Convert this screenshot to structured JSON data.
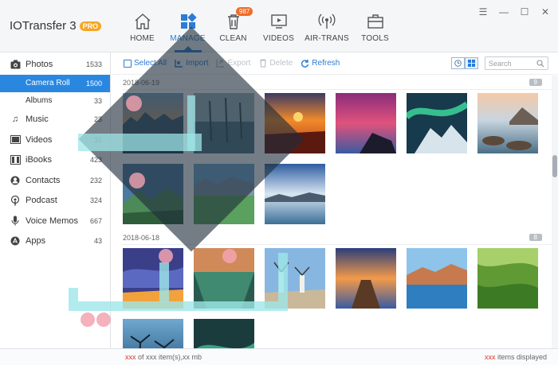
{
  "app": {
    "title": "IOTransfer 3",
    "pro_badge": "PRO"
  },
  "nav": {
    "items": [
      {
        "id": "home",
        "label": "HOME",
        "icon": "home-icon"
      },
      {
        "id": "manage",
        "label": "MANAGE",
        "icon": "grid-icon",
        "active": true
      },
      {
        "id": "clean",
        "label": "CLEAN",
        "icon": "trash-icon",
        "badge": "987"
      },
      {
        "id": "videos",
        "label": "VIDEOS",
        "icon": "video-icon"
      },
      {
        "id": "airtrans",
        "label": "AIR-TRANS",
        "icon": "wifi-icon"
      },
      {
        "id": "tools",
        "label": "TOOLS",
        "icon": "toolbox-icon"
      }
    ],
    "accent": "#2a7cd6"
  },
  "sidebar": {
    "items": [
      {
        "label": "Photos",
        "count": "1533",
        "icon": "camera-icon"
      },
      {
        "label": "Camera Roll",
        "count": "1500",
        "sub": true,
        "active": true
      },
      {
        "label": "Albums",
        "count": "33",
        "sub": true
      },
      {
        "label": "Music",
        "count": "23",
        "icon": "music-icon"
      },
      {
        "label": "Videos",
        "count": "32",
        "icon": "film-icon"
      },
      {
        "label": "iBooks",
        "count": "423",
        "icon": "book-icon"
      },
      {
        "label": "Contacts",
        "count": "232",
        "icon": "contacts-icon"
      },
      {
        "label": "Podcast",
        "count": "324",
        "icon": "podcast-icon"
      },
      {
        "label": "Voice Memos",
        "count": "667",
        "icon": "mic-icon"
      },
      {
        "label": "Apps",
        "count": "43",
        "icon": "apps-icon"
      }
    ]
  },
  "toolbar": {
    "select_all": "Select All",
    "import": "Import",
    "export": "Export",
    "delete": "Delete",
    "refresh": "Refresh",
    "search_placeholder": "Search"
  },
  "gallery": {
    "groups": [
      {
        "date": "2018-06-19",
        "count": "9"
      },
      {
        "date": "2018-06-18",
        "count": "8"
      }
    ]
  },
  "status": {
    "left_prefix": "xxx",
    "left_mid": " of ",
    "left_value": "xxx",
    "left_suffix": " item(s),xx mb",
    "right_value": "xxx",
    "right_suffix": " items displayed"
  }
}
